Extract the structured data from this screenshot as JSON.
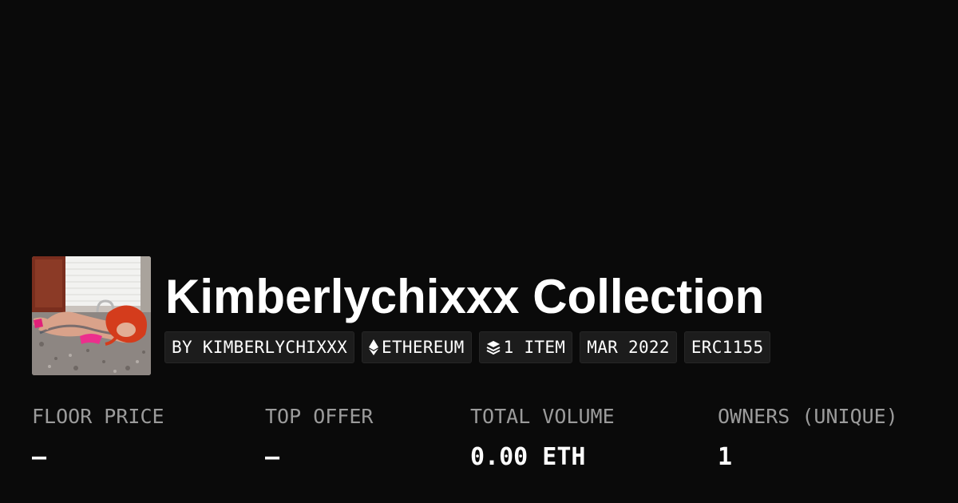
{
  "collection": {
    "title": "Kimberlychixxx Collection"
  },
  "tags": {
    "creator": "BY KIMBERLYCHIXXX",
    "chain": "ETHEREUM",
    "chain_icon": "ethereum-icon",
    "items": "1 ITEM",
    "items_icon": "layers-icon",
    "date": "MAR 2022",
    "standard": "ERC1155"
  },
  "stats": {
    "floor_price": {
      "label": "FLOOR PRICE",
      "value": "–"
    },
    "top_offer": {
      "label": "TOP OFFER",
      "value": "–"
    },
    "total_volume": {
      "label": "TOTAL VOLUME",
      "value": "0.00 ETH"
    },
    "owners": {
      "label": "OWNERS (UNIQUE)",
      "value": "1"
    }
  },
  "colors": {
    "background": "#0a0a0a",
    "tag_background": "#1c1c1c",
    "label_gray": "#9b9b9b",
    "text": "#ffffff"
  }
}
